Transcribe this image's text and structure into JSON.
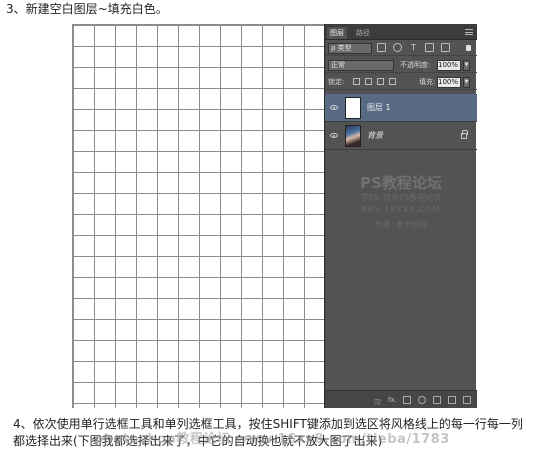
{
  "step_three": "3、新建空白图层~填充白色。",
  "layers_panel": {
    "tabs": [
      "图层",
      "路径"
    ],
    "filter_label": "ρ 类型",
    "blend_mode": "正常",
    "opacity_label": "不透明度:",
    "opacity_value": "100%",
    "lock_label": "锁定:",
    "fill_label": "填充:",
    "fill_value": "100%",
    "layers": [
      {
        "name": "图层 1",
        "selected": true
      },
      {
        "name": "背景",
        "selected": false,
        "locked": true
      }
    ],
    "bottom_icons": [
      "link-icon",
      "fx-icon",
      "mask-icon",
      "adjustment-icon",
      "group-icon",
      "new-layer-icon",
      "trash-icon"
    ],
    "bottom_glyphs": [
      "ဣ",
      "fx.",
      "◘",
      "◐",
      "▬",
      "▣",
      "🗑"
    ]
  },
  "panel_watermark": {
    "title": "PS教程论坛",
    "line2": "学PS, 就到PS教程论坛",
    "line3": "BBS.16XX8.COM",
    "line4": "作者: #卡乐筠"
  },
  "step_four": "4、依次使用单行选框工具和单列选框工具，按住SHIFT键添加到选区将风格线上的每一行每一列都选择出来(下图我都选择出来了，中它的自动换也就不放大图了出来)",
  "overlay_watermark": "photoshop教程论坛 www.16xx8.com/tieba/1783"
}
